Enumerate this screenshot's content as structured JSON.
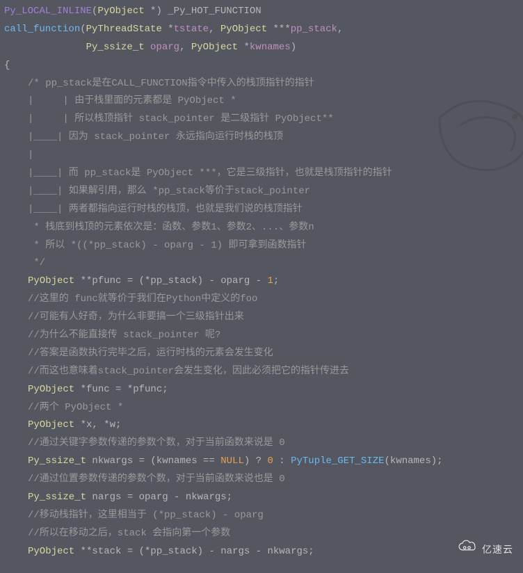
{
  "code": {
    "l01_a": "Py_LOCAL_INLINE",
    "l01_b": "(",
    "l01_c": "PyObject",
    "l01_d": " *) _Py_HOT_FUNCTION",
    "l02_a": "call_function",
    "l02_b": "(",
    "l02_c": "PyThreadState",
    "l02_d": " *",
    "l02_e": "tstate",
    "l02_f": ", ",
    "l02_g": "PyObject",
    "l02_h": " ***",
    "l02_i": "pp_stack",
    "l02_j": ",",
    "l03_a": "Py_ssize_t",
    "l03_b": " ",
    "l03_c": "oparg",
    "l03_d": ", ",
    "l03_e": "PyObject",
    "l03_f": " *",
    "l03_g": "kwnames",
    "l03_h": ")",
    "l04": "{",
    "c01": "/* pp_stack是在CALL_FUNCTION指令中传入的栈顶指针的指针",
    "c02": "|     | 由于栈里面的元素都是 PyObject *",
    "c03": "|     | 所以栈顶指针 stack_pointer 是二级指针 PyObject**",
    "c04": "|____| 因为 stack_pointer 永远指向运行时栈的栈顶",
    "c05": "|",
    "c06": "|____| 而 pp_stack是 PyObject ***，它是三级指针，也就是栈顶指针的指针",
    "c07": "|____| 如果解引用，那么 *pp_stack等价于stack_pointer",
    "c08": "|____| 两者都指向运行时栈的栈顶，也就是我们说的栈顶指针",
    "c09": " * 栈底到栈顶的元素依次是：函数、参数1、参数2、...、参数n",
    "c10": " * 所以 *((*pp_stack) - oparg - 1) 即可拿到函数指针",
    "c11": " */",
    "s1_a": "PyObject",
    "s1_b": " **pfunc = (*pp_stack) - oparg - ",
    "s1_c": "1",
    "s1_d": ";",
    "c12": "//这里的 func就等价于我们在Python中定义的foo",
    "c13": "//可能有人好奇，为什么非要搞一个三级指针出来",
    "c14": "//为什么不能直接传 stack_pointer 呢?",
    "c15": "//答案是函数执行完毕之后，运行时栈的元素会发生变化",
    "c16": "//而这也意味着stack_pointer会发生变化，因此必须把它的指针传进去",
    "s2_a": "PyObject",
    "s2_b": " *func = *pfunc;",
    "c17": "//两个 PyObject *",
    "s3_a": "PyObject",
    "s3_b": " *x, *w;",
    "c18": "//通过关键字参数传递的参数个数，对于当前函数来说是 0",
    "s4_a": "Py_ssize_t",
    "s4_b": " nkwargs = (kwnames == ",
    "s4_c": "NULL",
    "s4_d": ") ? ",
    "s4_e": "0",
    "s4_f": " : ",
    "s4_g": "PyTuple_GET_SIZE",
    "s4_h": "(kwnames);",
    "c19": "//通过位置参数传递的参数个数，对于当前函数来说也是 0",
    "s5_a": "Py_ssize_t",
    "s5_b": " nargs = oparg - nkwargs;",
    "c20": "//移动栈指针，这里相当于 (*pp_stack) - oparg",
    "c21": "//所以在移动之后，stack 会指向第一个参数",
    "s6_a": "PyObject",
    "s6_b": " **stack = (*pp_stack) - nargs - nkwargs;"
  },
  "watermark": "亿速云"
}
